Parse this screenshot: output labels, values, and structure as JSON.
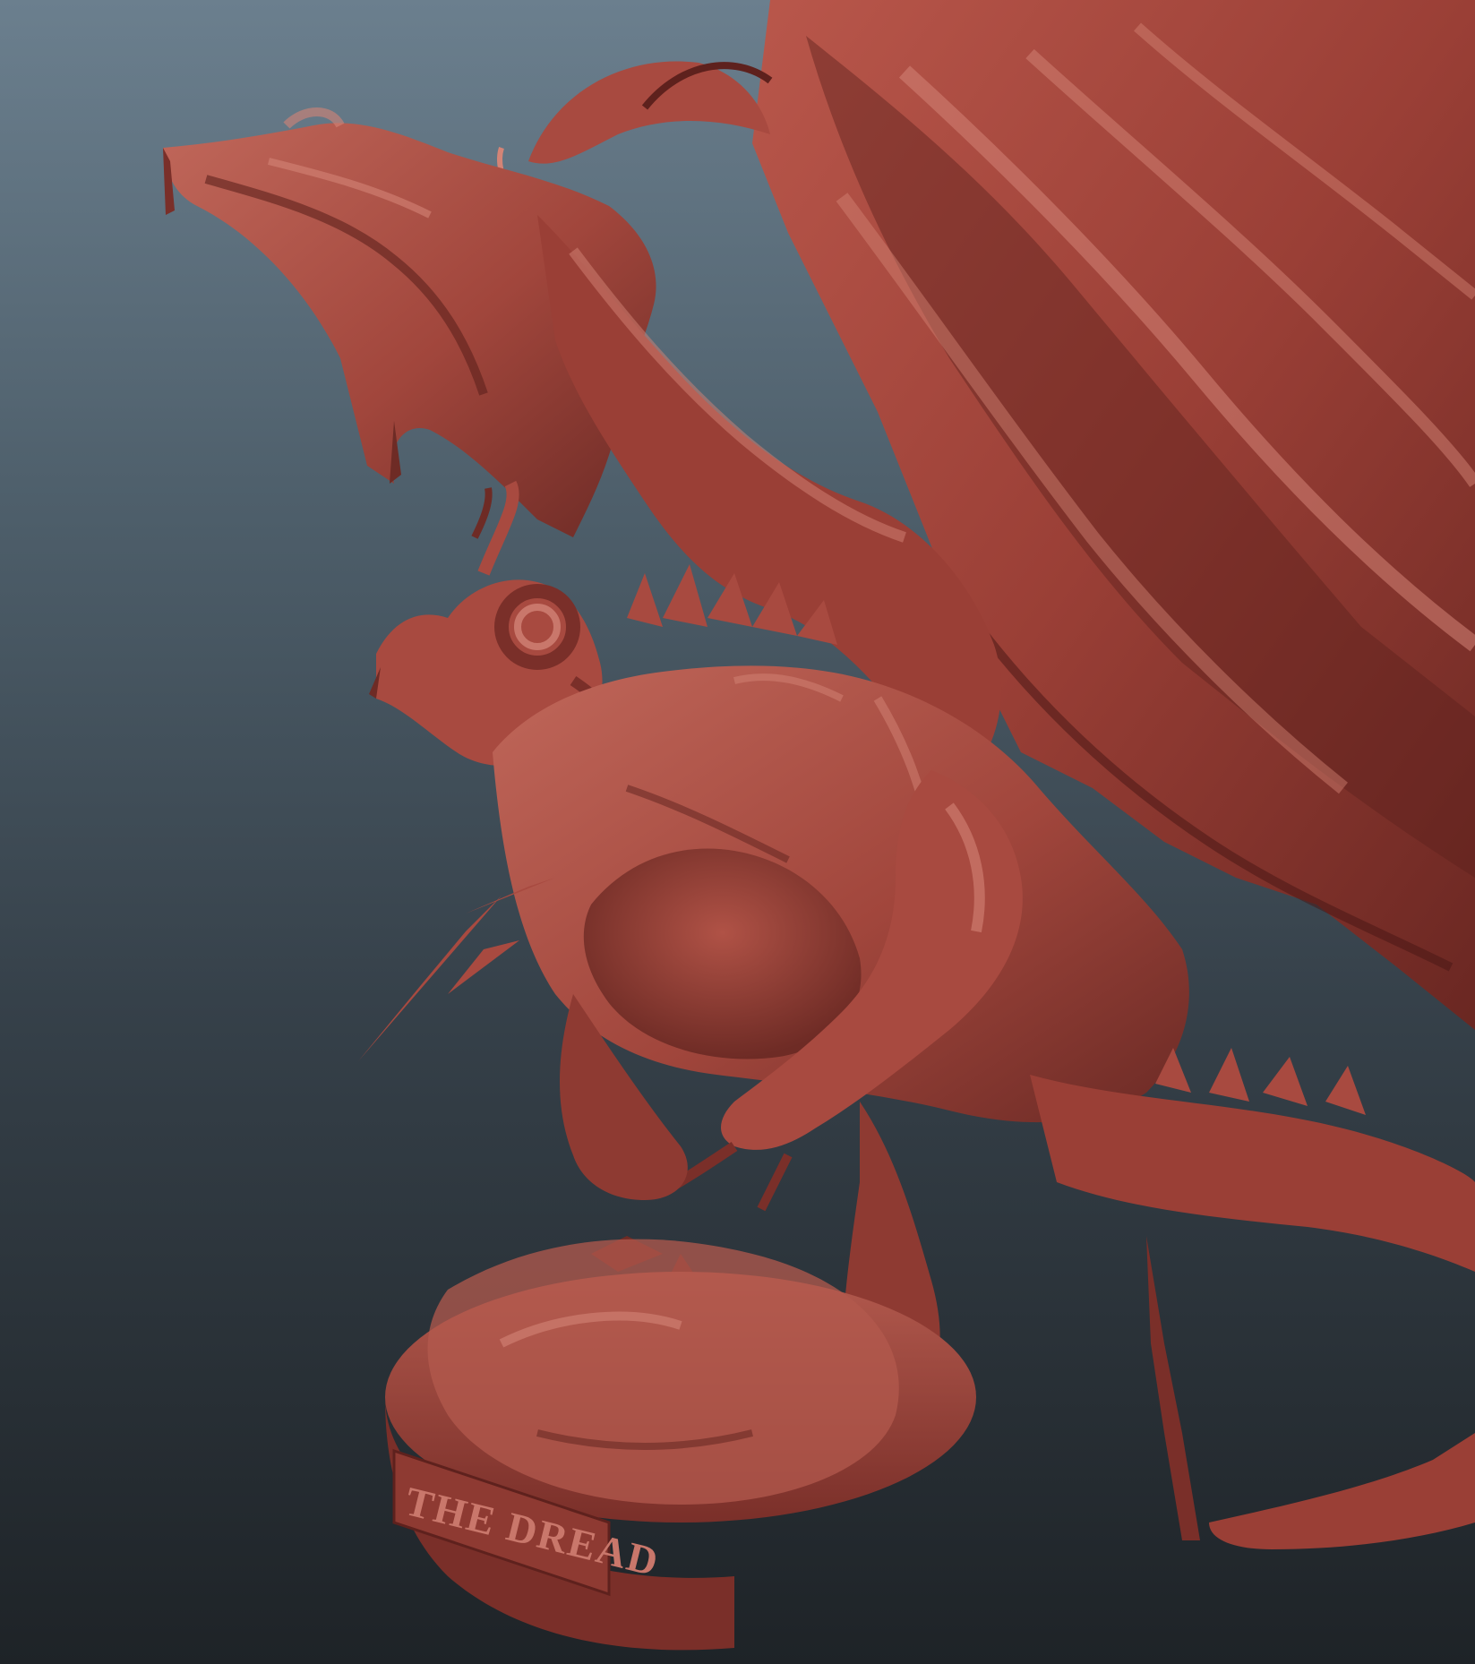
{
  "scene": {
    "plaque_text": "THE DREAD",
    "colors": {
      "background_top": "#6b7f8e",
      "background_bottom": "#1e2327",
      "clay_base": "#a44a40",
      "clay_light": "#c9776b",
      "clay_dark": "#5e211d",
      "clay_shadow": "#3e1513"
    }
  }
}
